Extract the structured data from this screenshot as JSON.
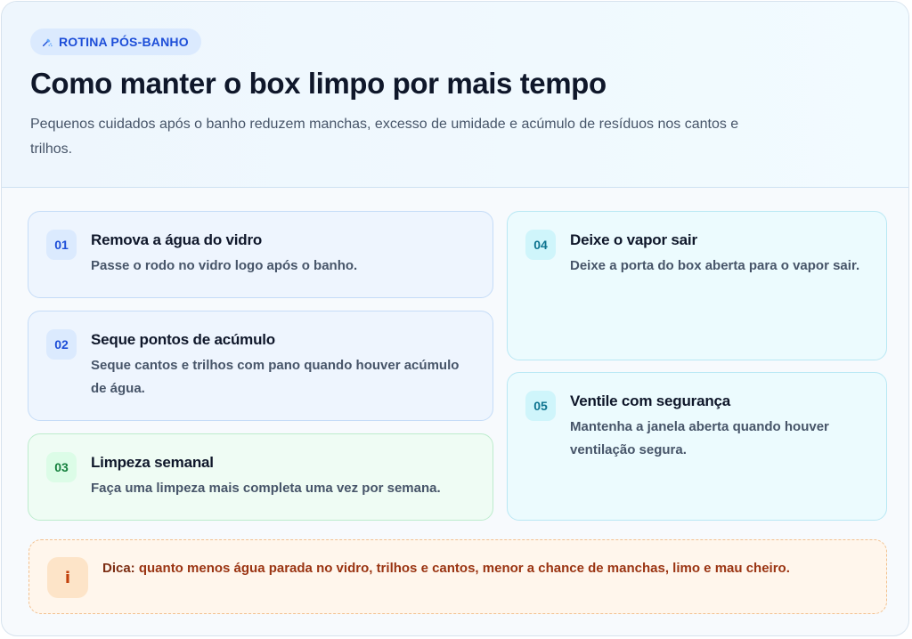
{
  "header": {
    "badge_label": "ROTINA PÓS-BANHO",
    "badge_icon": "shower-icon",
    "title": "Como manter o box limpo por mais tempo",
    "subtitle": "Pequenos cuidados após o banho reduzem manchas, excesso de umidade e acúmulo de resíduos nos cantos e trilhos."
  },
  "steps": [
    {
      "number": "01",
      "title": "Remova a água do vidro",
      "text": "Passe o rodo no vidro logo após o banho.",
      "accent": "#1d4ed8"
    },
    {
      "number": "02",
      "title": "Seque pontos de acúmulo",
      "text": "Seque cantos e trilhos com pano quando houver acúmulo de água.",
      "accent": "#1d4ed8"
    },
    {
      "number": "03",
      "title": "Limpeza semanal",
      "text": "Faça uma limpeza mais completa uma vez por semana.",
      "accent": "#15803d"
    },
    {
      "number": "04",
      "title": "Deixe o vapor sair",
      "text": "Deixe a porta do box aberta para o vapor sair.",
      "accent": "#0e7490"
    },
    {
      "number": "05",
      "title": "Ventile com segurança",
      "text": "Mantenha a janela aberta quando houver ventilação segura.",
      "accent": "#0e7490"
    }
  ],
  "tip": {
    "icon_glyph": "i",
    "label": "Dica:",
    "text": "quanto menos água parada no vidro, trilhos e cantos, menor a chance de manchas, limo e mau cheiro.",
    "accent": "#c2410c"
  }
}
